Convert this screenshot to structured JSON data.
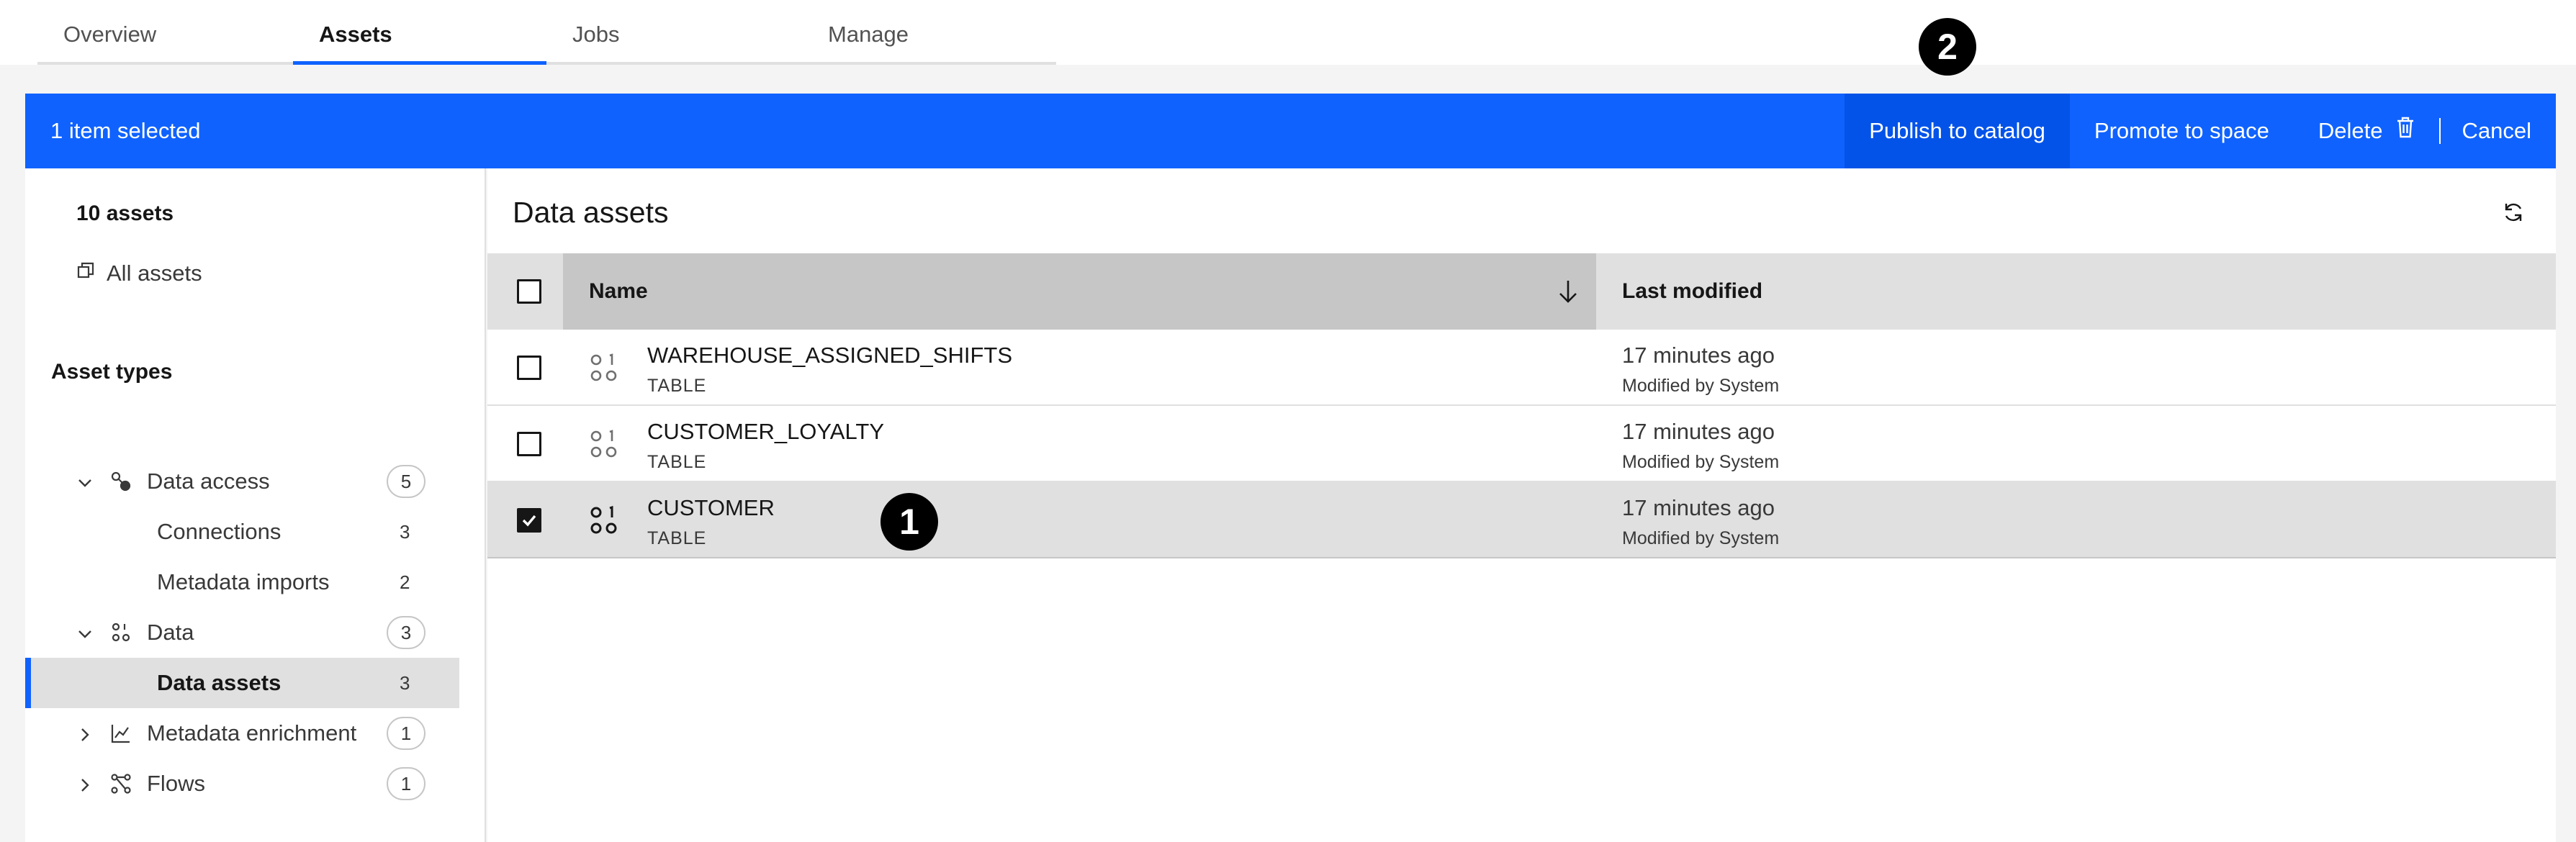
{
  "tabs": [
    {
      "label": "Overview"
    },
    {
      "label": "Assets"
    },
    {
      "label": "Jobs"
    },
    {
      "label": "Manage"
    }
  ],
  "selection_bar": {
    "count_text": "1 item selected",
    "publish_label": "Publish to catalog",
    "promote_label": "Promote to space",
    "delete_label": "Delete",
    "cancel_label": "Cancel"
  },
  "sidebar": {
    "asset_count": "10 assets",
    "all_assets": "All assets",
    "asset_types_heading": "Asset types",
    "tree": [
      {
        "label": "Data access",
        "count": "5"
      },
      {
        "label": "Connections",
        "count": "3"
      },
      {
        "label": "Metadata imports",
        "count": "2"
      },
      {
        "label": "Data",
        "count": "3"
      },
      {
        "label": "Data assets",
        "count": "3"
      },
      {
        "label": "Metadata enrichment",
        "count": "1"
      },
      {
        "label": "Flows",
        "count": "1"
      }
    ]
  },
  "main": {
    "title": "Data assets",
    "columns": {
      "name": "Name",
      "last_modified": "Last modified"
    },
    "rows": [
      {
        "name": "WAREHOUSE_ASSIGNED_SHIFTS",
        "type": "TABLE",
        "modified": "17 minutes ago",
        "modified_by": "Modified by System",
        "checked": false
      },
      {
        "name": "CUSTOMER_LOYALTY",
        "type": "TABLE",
        "modified": "17 minutes ago",
        "modified_by": "Modified by System",
        "checked": false
      },
      {
        "name": "CUSTOMER",
        "type": "TABLE",
        "modified": "17 minutes ago",
        "modified_by": "Modified by System",
        "checked": true
      }
    ]
  },
  "callouts": {
    "first": "1",
    "second": "2"
  },
  "colors": {
    "accent": "#0f62fe",
    "selected_row": "#e0e0e0",
    "header_sorted": "#c6c6c6"
  }
}
